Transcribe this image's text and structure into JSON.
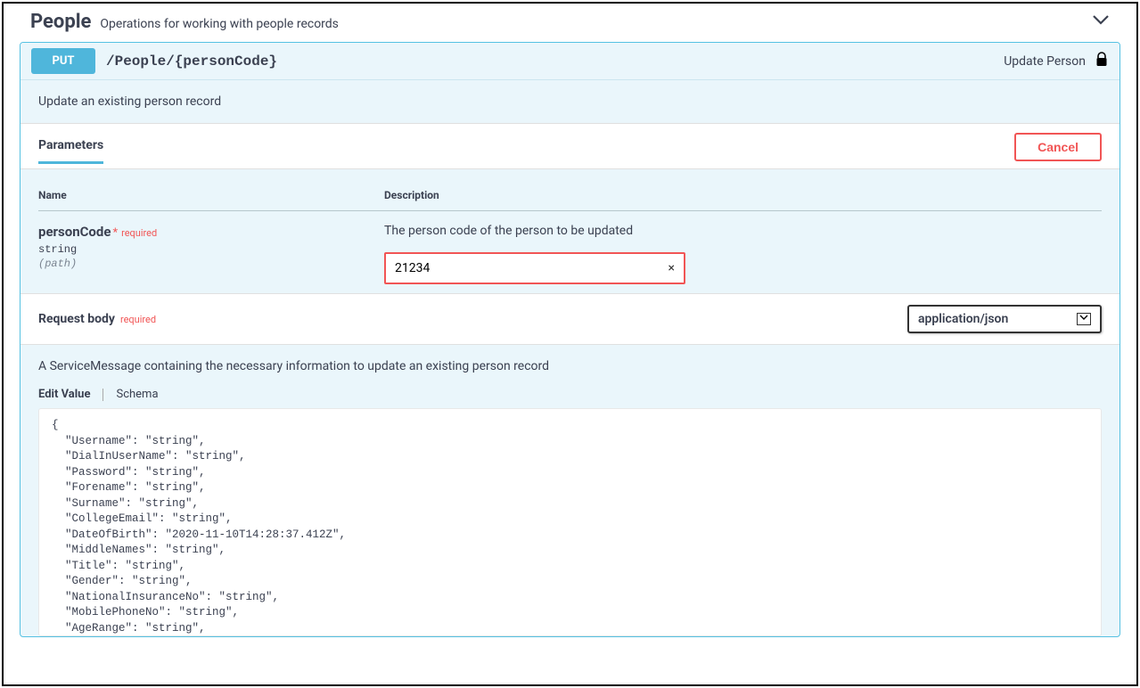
{
  "section": {
    "title": "People",
    "description": "Operations for working with people records"
  },
  "operation": {
    "method": "PUT",
    "path": "/People/{personCode}",
    "summary": "Update Person",
    "description": "Update an existing person record"
  },
  "parameters": {
    "tab_label": "Parameters",
    "cancel_label": "Cancel",
    "headers": {
      "name": "Name",
      "description": "Description"
    },
    "items": [
      {
        "name": "personCode",
        "required_star": "*",
        "required_text": "required",
        "type": "string",
        "location": "(path)",
        "description": "The person code of the person to be updated",
        "value": "21234",
        "clear": "×"
      }
    ]
  },
  "request_body": {
    "title": "Request body",
    "required_text": "required",
    "content_type": "application/json",
    "description": "A ServiceMessage containing the necessary information to update an existing person record",
    "tabs": {
      "edit": "Edit Value",
      "schema": "Schema"
    },
    "json_text": "{\n  \"Username\": \"string\",\n  \"DialInUserName\": \"string\",\n  \"Password\": \"string\",\n  \"Forename\": \"string\",\n  \"Surname\": \"string\",\n  \"CollegeEmail\": \"string\",\n  \"DateOfBirth\": \"2020-11-10T14:28:37.412Z\",\n  \"MiddleNames\": \"string\",\n  \"Title\": \"string\",\n  \"Gender\": \"string\",\n  \"NationalInsuranceNo\": \"string\",\n  \"MobilePhoneNo\": \"string\",\n  \"AgeRange\": \"string\",\n  \"CollegeLogin\": \"string\",\n  \"ConnexionsID\": \"string\",\n  \"ContactPreferenceMethod\": \"string\","
  }
}
